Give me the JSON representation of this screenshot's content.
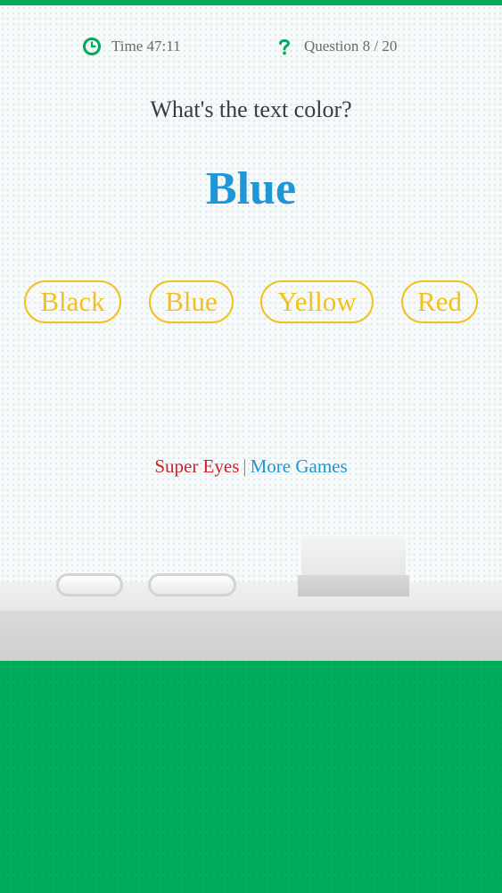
{
  "header": {
    "time_label": "Time 47:11",
    "question_label": "Question 8 / 20",
    "time_icon": "clock-icon",
    "question_icon": "question-icon"
  },
  "prompt": "What's the text color?",
  "word": {
    "text": "Blue",
    "color": "#1f96d6"
  },
  "answers": [
    {
      "label": "Black"
    },
    {
      "label": "Blue"
    },
    {
      "label": "Yellow"
    },
    {
      "label": "Red"
    }
  ],
  "footer_links": {
    "left": "Super Eyes",
    "separator": "|",
    "right": "More Games"
  },
  "colors": {
    "accent_green": "#00aa5a",
    "answer_yellow": "#f1c21b",
    "link_red": "#d0202a",
    "link_blue": "#1f96d6",
    "text_dark": "#333d45"
  }
}
